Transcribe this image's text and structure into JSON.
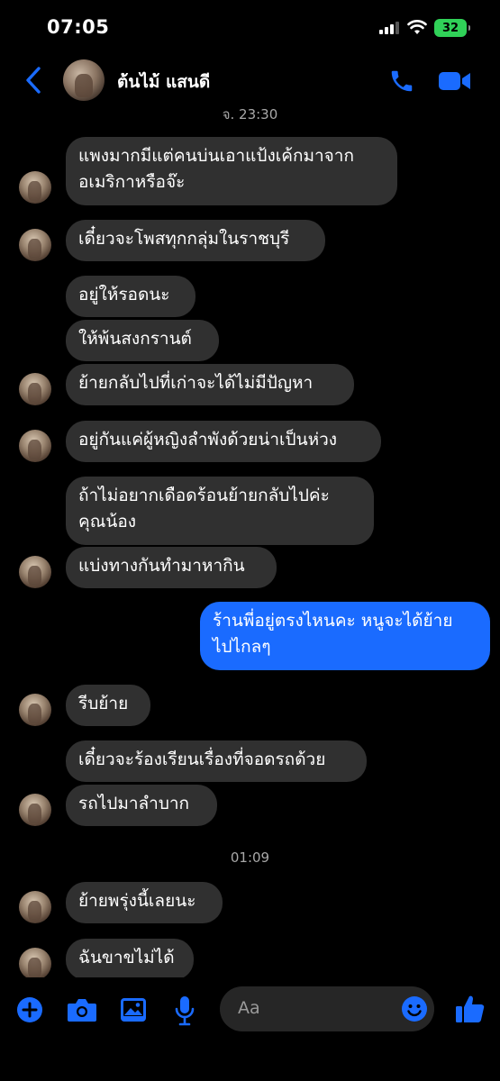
{
  "status_bar": {
    "time": "07:05",
    "battery": "32"
  },
  "header": {
    "contact_name": "ต้นไม้ แสนดี"
  },
  "timestamps": [
    "จ. 23:30",
    "01:09"
  ],
  "messages": [
    {
      "text": "แพงมากมีแต่คนบ่นเอาแป้งเค้กมาจาก\nอเมริกาหรือจ๊ะ",
      "from": "them"
    },
    {
      "text": "เดี๋ยวจะโพสทุกกลุ่มในราชบุรี",
      "from": "them"
    },
    {
      "text": "อยู่ให้รอดนะ",
      "from": "them"
    },
    {
      "text": "ให้พ้นสงกรานต์",
      "from": "them"
    },
    {
      "text": "ย้ายกลับไปที่เก่าจะได้ไม่มีปัญหา",
      "from": "them"
    },
    {
      "text": "อยู่กันแค่ผู้หญิงลำพังด้วยน่าเป็นห่วง",
      "from": "them"
    },
    {
      "text": "ถ้าไม่อยากเดือดร้อนย้ายกลับไปค่ะ\nคุณน้อง",
      "from": "them"
    },
    {
      "text": "แบ่งทางกันทำมาหากิน",
      "from": "them"
    },
    {
      "text": "ร้านพี่อยู่ตรงไหนคะ หนูจะได้ย้าย\nไปไกลๆ",
      "from": "me"
    },
    {
      "text": "รีบย้าย",
      "from": "them"
    },
    {
      "text": "เดี๋ยวจะร้องเรียนเรื่องที่จอดรถด้วย",
      "from": "them"
    },
    {
      "text": "รถไปมาลำบาก",
      "from": "them"
    },
    {
      "text": "ย้ายพรุ่งนี้เลยนะ",
      "from": "them"
    },
    {
      "text": "ฉันขาขไม่ได้",
      "from": "them"
    }
  ],
  "composer": {
    "placeholder": "Aa"
  },
  "colors": {
    "accent": "#1a6bff",
    "bubble_them": "#303030",
    "background": "#000000"
  },
  "icons": [
    "back-chevron-icon",
    "phone-icon",
    "video-camera-icon",
    "plus-icon",
    "camera-icon",
    "image-icon",
    "microphone-icon",
    "emoji-icon",
    "thumbs-up-icon"
  ]
}
